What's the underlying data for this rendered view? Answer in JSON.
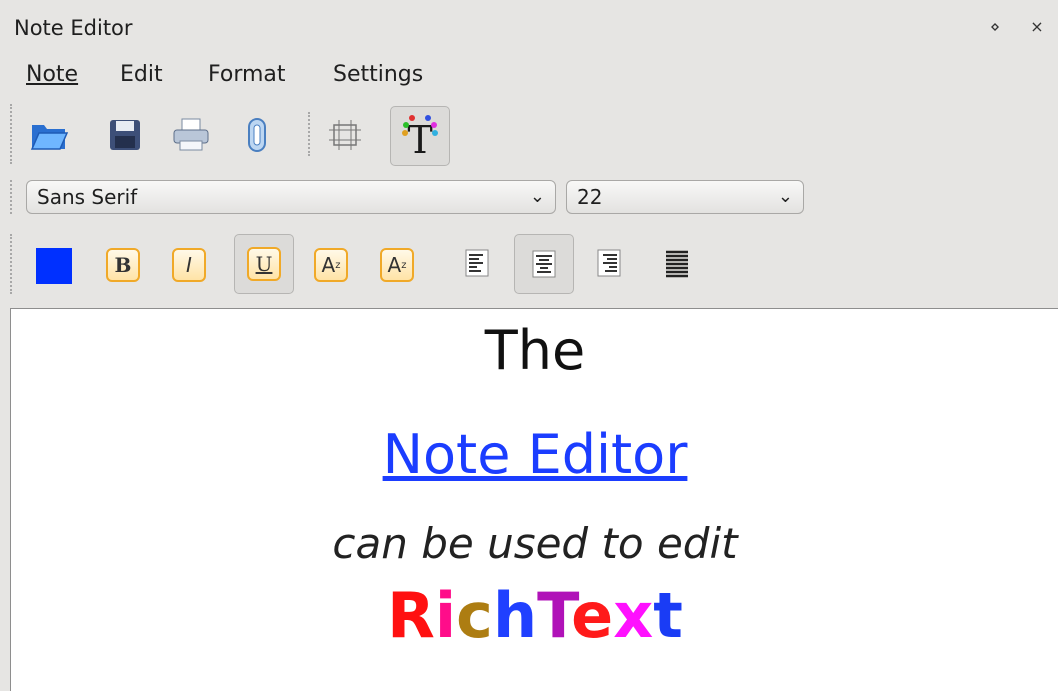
{
  "window": {
    "title": "Note Editor",
    "pin_glyph": "⋄",
    "close_glyph": "×"
  },
  "menu": [
    {
      "label": "Note"
    },
    {
      "label": "Edit"
    },
    {
      "label": "Format"
    },
    {
      "label": "Settings"
    }
  ],
  "toolbar": {
    "icons": [
      "open-folder-icon",
      "save-disk-icon",
      "printer-icon",
      "attach-clip-icon",
      "insert-frame-icon",
      "rich-text-icon"
    ]
  },
  "font": {
    "family_value": "Sans Serif",
    "size_value": "22",
    "arrow": "⌄"
  },
  "format": {
    "text_color": "#0030ff",
    "bold_label": "B",
    "italic_label": "I",
    "underline_label": "U",
    "subscript_label": "A",
    "superscript_label": "A",
    "sub_mark": "z",
    "sup_mark": "z"
  },
  "document": {
    "line1": "The",
    "line2": "Note Editor",
    "line3": "can be used to edit",
    "rich": [
      {
        "ch": "R",
        "color": "#ff1010"
      },
      {
        "ch": "i",
        "color": "#ff0d8a"
      },
      {
        "ch": "c",
        "color": "#ad7d12"
      },
      {
        "ch": "h",
        "color": "#2040ff"
      },
      {
        "ch": "T",
        "color": "#b012b8"
      },
      {
        "ch": "e",
        "color": "#ff1a1a"
      },
      {
        "ch": "x",
        "color": "#ff10ff"
      },
      {
        "ch": "t",
        "color": "#1a3cf5"
      }
    ],
    "link_color": "#1b3dff"
  }
}
